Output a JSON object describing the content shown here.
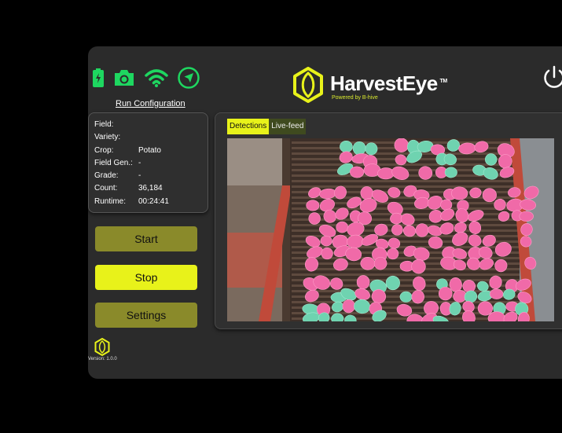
{
  "app": {
    "name": "HarvestEye",
    "trademark": "TM",
    "tagline": "Powered by B-hive",
    "version": "Version: 1.0.0"
  },
  "colors": {
    "accent": "#e8f21a",
    "status_green": "#1ed760",
    "dim_button": "#8a8a2a"
  },
  "status_icons": [
    "battery-icon",
    "camera-icon",
    "wifi-icon",
    "gps-icon"
  ],
  "run_configuration": "Run Configuration",
  "info": [
    {
      "label": "Field:",
      "value": ""
    },
    {
      "label": "Variety:",
      "value": ""
    },
    {
      "label": "Crop:",
      "value": "Potato"
    },
    {
      "label": "Field Gen.:",
      "value": "-"
    },
    {
      "label": "Grade:",
      "value": "-"
    },
    {
      "label": "Count:",
      "value": "36,184"
    },
    {
      "label": "Runtime:",
      "value": "00:24:41"
    }
  ],
  "buttons": {
    "start": "Start",
    "stop": "Stop",
    "settings": "Settings"
  },
  "tabs": [
    {
      "label": "Detections",
      "active": true
    },
    {
      "label": "Live-feed",
      "active": false
    }
  ]
}
